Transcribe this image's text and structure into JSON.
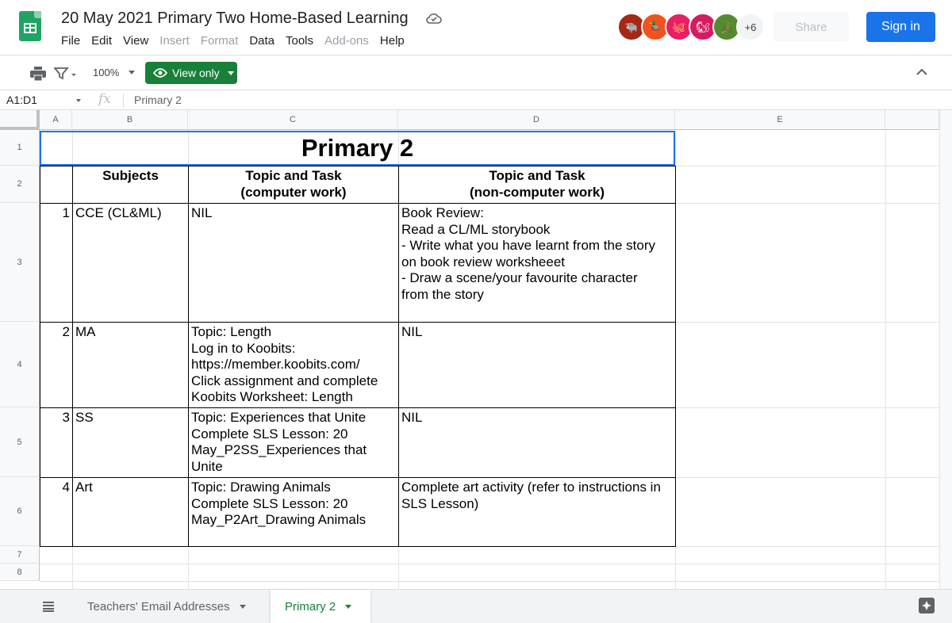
{
  "doc": {
    "title": "20 May 2021 Primary Two Home-Based Learning"
  },
  "menu": [
    "File",
    "Edit",
    "View",
    "Insert",
    "Format",
    "Data",
    "Tools",
    "Add-ons",
    "Help"
  ],
  "collaborators": {
    "more_label": "+6",
    "colors": [
      "#a52714",
      "#f4511e",
      "#e91e63",
      "#d81b60",
      "#558b2f"
    ]
  },
  "header_buttons": {
    "share": "Share",
    "sign_in": "Sign in"
  },
  "toolbar": {
    "zoom": "100%",
    "view_only": "View only"
  },
  "formula_bar": {
    "name_box": "A1:D1",
    "fx": "fx",
    "value": "Primary 2"
  },
  "columns": [
    "A",
    "B",
    "C",
    "D",
    "E"
  ],
  "rows": [
    "1",
    "2",
    "3",
    "4",
    "5",
    "6",
    "7",
    "8"
  ],
  "sheet": {
    "title": "Primary 2",
    "headers": {
      "subjects": "Subjects",
      "computer": "Topic and Task\n(computer work)",
      "noncomputer": "Topic and Task\n(non-computer work)"
    },
    "entries": [
      {
        "num": "1",
        "subject": "CCE (CL&ML)",
        "computer": "NIL",
        "noncomputer": "Book Review:\nRead a CL/ML storybook\n- Write what you have learnt from the story on book review worksheeet\n- Draw a scene/your favourite character\n  from the story"
      },
      {
        "num": "2",
        "subject": "MA",
        "computer": "Topic: Length\nLog in to Koobits:\nhttps://member.koobits.com/\nClick assignment and complete Koobits Worksheet: Length",
        "noncomputer": "NIL"
      },
      {
        "num": "3",
        "subject": "SS",
        "computer": "Topic: Experiences that Unite\nComplete SLS Lesson: 20 May_P2SS_Experiences that Unite",
        "noncomputer": "NIL"
      },
      {
        "num": "4",
        "subject": "Art",
        "computer": "Topic: Drawing Animals\nComplete SLS Lesson: 20 May_P2Art_Drawing Animals",
        "noncomputer": "Complete art activity (refer to instructions in SLS Lesson)"
      }
    ]
  },
  "tabs": [
    {
      "label": "Teachers' Email Addresses"
    },
    {
      "label": "Primary 2"
    }
  ],
  "colors": {
    "accent_green": "#188038",
    "sign_in_blue": "#1a73e8",
    "selection_blue": "#1a73e8"
  }
}
